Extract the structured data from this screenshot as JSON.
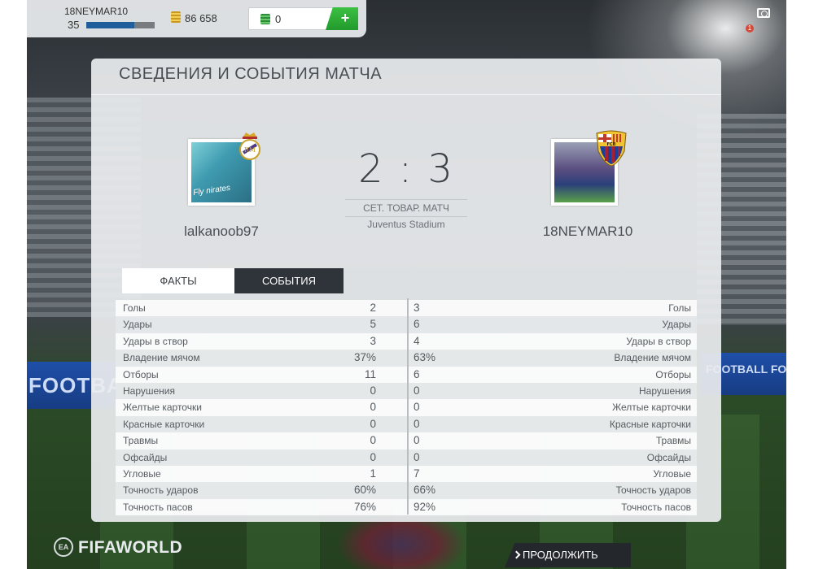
{
  "hud": {
    "player_name": "18NEYMAR10",
    "level": "35",
    "xp_progress": 0.7,
    "coins": "86 658",
    "points": "0",
    "add_points_label": "+"
  },
  "background": {
    "banner_left": "FOOTBA",
    "banner_right": "FOOTBALL FOR",
    "notification_count": "1"
  },
  "dialog": {
    "title": "СВЕДЕНИЯ И СОБЫТИЯ МАТЧА",
    "home_team": "lalkanoob97",
    "away_team": "18NEYMAR10",
    "score": "2 : 3",
    "match_type": "СЕТ. ТОВАР. МАТЧ",
    "stadium": "Juventus Stadium",
    "tabs": [
      {
        "label": "ФАКТЫ",
        "active": true
      },
      {
        "label": "СОБЫТИЯ",
        "active": false
      }
    ],
    "stats": [
      {
        "label": "Голы",
        "home": "2",
        "away": "3"
      },
      {
        "label": "Удары",
        "home": "5",
        "away": "6"
      },
      {
        "label": "Удары в створ",
        "home": "3",
        "away": "4"
      },
      {
        "label": "Владение мячом",
        "home": "37%",
        "away": "63%"
      },
      {
        "label": "Отборы",
        "home": "11",
        "away": "6"
      },
      {
        "label": "Нарушения",
        "home": "0",
        "away": "0"
      },
      {
        "label": "Желтые карточки",
        "home": "0",
        "away": "0"
      },
      {
        "label": "Красные карточки",
        "home": "0",
        "away": "0"
      },
      {
        "label": "Травмы",
        "home": "0",
        "away": "0"
      },
      {
        "label": "Офсайды",
        "home": "0",
        "away": "0"
      },
      {
        "label": "Угловые",
        "home": "1",
        "away": "7"
      },
      {
        "label": "Точность ударов",
        "home": "60%",
        "away": "66%"
      },
      {
        "label": "Точность пасов",
        "home": "76%",
        "away": "92%"
      }
    ]
  },
  "footer": {
    "logo_text": "FIFAWORLD",
    "continue_label": "ПРОДОЛЖИТЬ"
  },
  "colors": {
    "accent_green": "#2fae37",
    "tab_active_bg": "#ffffff",
    "tab_inactive_bg": "#2f343a",
    "xp_bar": "#1f5e9a"
  }
}
